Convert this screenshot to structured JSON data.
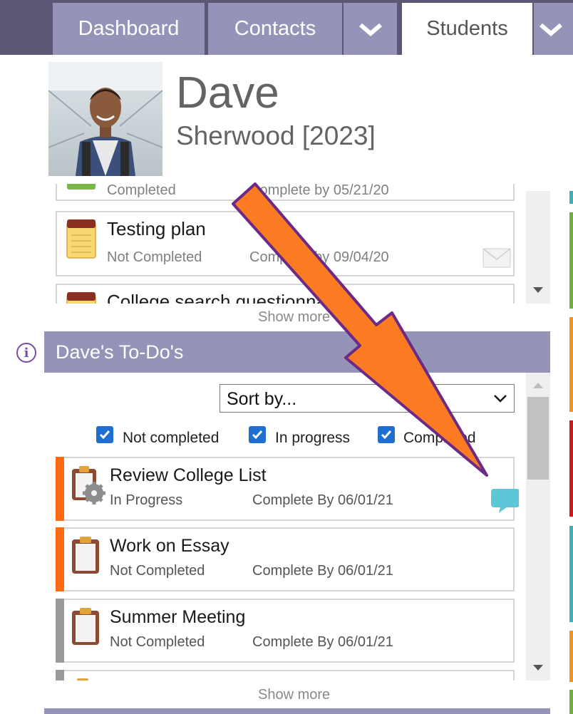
{
  "nav": {
    "tabs": [
      {
        "label": "Dashboard"
      },
      {
        "label": "Contacts"
      },
      {
        "label": "Students"
      }
    ]
  },
  "student": {
    "first_name": "Dave",
    "last_name_year": "Sherwood [2023]"
  },
  "tasks_panel": {
    "items": [
      {
        "title": "",
        "status": "Completed",
        "date": "Complete by 05/21/20"
      },
      {
        "title": "Testing plan",
        "status": "Not Completed",
        "date": "Complete by 09/04/20"
      },
      {
        "title": "College search questionnaires",
        "status": "",
        "date": ""
      }
    ],
    "show_more": "Show more"
  },
  "todos": {
    "header": "Dave's To-Do's",
    "sort_label": "Sort by...",
    "filters": [
      {
        "label": "Not completed",
        "checked": true
      },
      {
        "label": "In progress",
        "checked": true
      },
      {
        "label": "Completed",
        "checked": true
      }
    ],
    "items": [
      {
        "title": "Review College List",
        "status": "In Progress",
        "date": "Complete By 06/01/21",
        "bar_color": "#ff6a13"
      },
      {
        "title": "Work on Essay",
        "status": "Not Completed",
        "date": "Complete By 06/01/21",
        "bar_color": "#ff6a13"
      },
      {
        "title": "Summer Meeting",
        "status": "Not Completed",
        "date": "Complete By 06/01/21",
        "bar_color": "#9a9a9a"
      }
    ],
    "show_more": "Show more"
  },
  "colors": {
    "nav_bg": "#5b5775",
    "tab_bg": "#9593b8",
    "header_bg": "#9593b8",
    "arrow_fill": "#fb7b22",
    "arrow_stroke": "#6b2a85",
    "checkbox": "#1e6fd0"
  },
  "icons": [
    "chevron-down-icon",
    "notepad-icon",
    "envelope-icon",
    "info-icon",
    "clipboard-gear-icon",
    "clipboard-icon",
    "chat-bubble-icon",
    "scroll-arrow-icon"
  ]
}
